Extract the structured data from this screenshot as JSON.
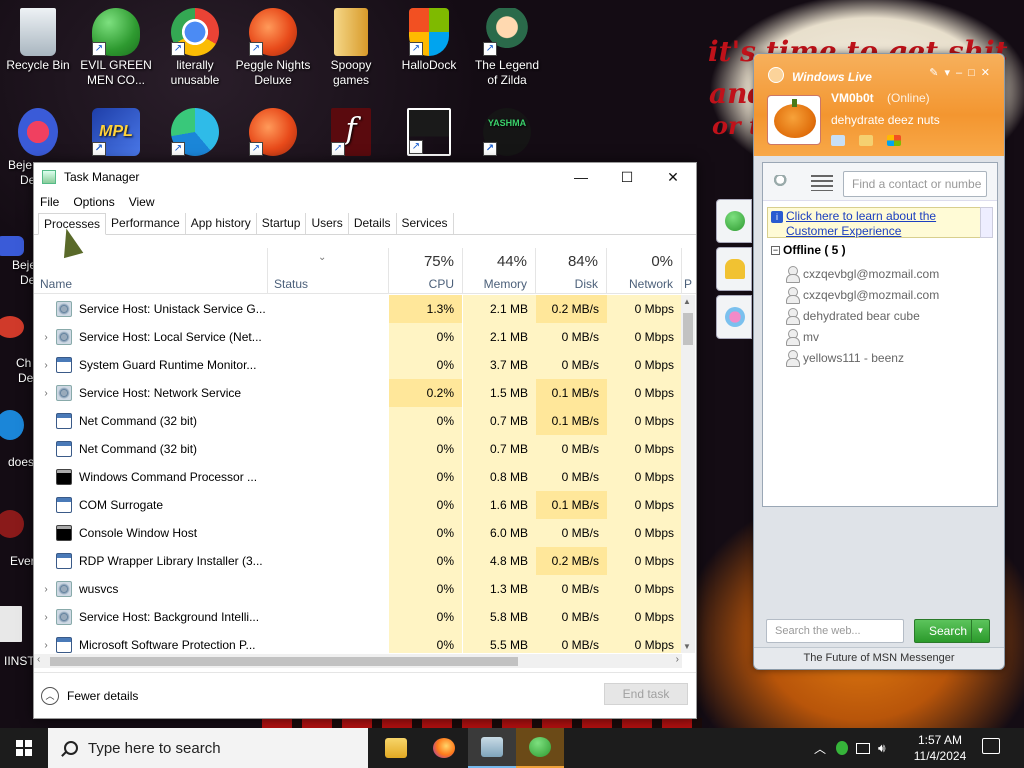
{
  "desktop": {
    "icons": [
      {
        "label": "Recycle Bin",
        "icon": "recycle-bin-icon",
        "color": "#cfd8e0"
      },
      {
        "label": "EVIL GREEN MEN CO...",
        "icon": "msn-buddies-icon",
        "color": "#36b43a"
      },
      {
        "label": "literally unusable",
        "icon": "chrome-icon",
        "color": "#e8453c"
      },
      {
        "label": "Peggle Nights Deluxe",
        "icon": "peggle-icon",
        "color": "#e84a1a"
      },
      {
        "label": "Spoopy games",
        "icon": "folder-zip-icon",
        "color": "#e8b74a"
      },
      {
        "label": "HalloDock",
        "icon": "windows-shield-icon",
        "color": "#f25022"
      },
      {
        "label": "The Legend of Zilda",
        "icon": "legend-zilda-icon",
        "color": "#3a8a3a"
      }
    ],
    "row2_icons": [
      {
        "label": "",
        "icon": "bejeweled-icon",
        "color": "#3a5bd8"
      },
      {
        "label": "",
        "icon": "mpl-icon",
        "color": "#1e3ea8"
      },
      {
        "label": "",
        "icon": "edge-icon",
        "color": "#1b86d8"
      },
      {
        "label": "",
        "icon": "peggle-icon",
        "color": "#e84a1a"
      },
      {
        "label": "",
        "icon": "flash-icon",
        "color": "#c8131a"
      },
      {
        "label": "",
        "icon": "rdp-icon",
        "color": "#ffffff"
      },
      {
        "label": "",
        "icon": "yashma-icon",
        "color": "#1a1a1a"
      }
    ],
    "partial_labels": [
      "Beje",
      "De",
      "Beje",
      "De",
      "Ch",
      "De",
      "does",
      "Ever",
      "IINST"
    ],
    "wall_text": [
      "it's time to get shit",
      "and",
      "or t"
    ]
  },
  "task_manager": {
    "title": "Task Manager",
    "menu": [
      "File",
      "Options",
      "View"
    ],
    "tabs": [
      "Processes",
      "Performance",
      "App history",
      "Startup",
      "Users",
      "Details",
      "Services"
    ],
    "active_tab": "Processes",
    "columns": {
      "name": "Name",
      "status": "Status",
      "cpu": {
        "pct": "75%",
        "label": "CPU"
      },
      "memory": {
        "pct": "44%",
        "label": "Memory"
      },
      "disk": {
        "pct": "84%",
        "label": "Disk"
      },
      "network": {
        "pct": "0%",
        "label": "Network"
      },
      "power": "P"
    },
    "rows": [
      {
        "expand": false,
        "icon": "svc",
        "name": "Service Host: Unistack Service G...",
        "cpu": "1.3%",
        "mem": "2.1 MB",
        "disk": "0.2 MB/s",
        "net": "0 Mbps"
      },
      {
        "expand": true,
        "icon": "svc",
        "name": "Service Host: Local Service (Net...",
        "cpu": "0%",
        "mem": "2.1 MB",
        "disk": "0 MB/s",
        "net": "0 Mbps"
      },
      {
        "expand": true,
        "icon": "win",
        "name": "System Guard Runtime Monitor...",
        "cpu": "0%",
        "mem": "3.7 MB",
        "disk": "0 MB/s",
        "net": "0 Mbps"
      },
      {
        "expand": true,
        "icon": "svc",
        "name": "Service Host: Network Service",
        "cpu": "0.2%",
        "mem": "1.5 MB",
        "disk": "0.1 MB/s",
        "net": "0 Mbps"
      },
      {
        "expand": false,
        "icon": "win",
        "name": "Net Command (32 bit)",
        "cpu": "0%",
        "mem": "0.7 MB",
        "disk": "0.1 MB/s",
        "net": "0 Mbps"
      },
      {
        "expand": false,
        "icon": "win",
        "name": "Net Command (32 bit)",
        "cpu": "0%",
        "mem": "0.7 MB",
        "disk": "0 MB/s",
        "net": "0 Mbps"
      },
      {
        "expand": false,
        "icon": "cmd",
        "name": "Windows Command Processor ...",
        "cpu": "0%",
        "mem": "0.8 MB",
        "disk": "0 MB/s",
        "net": "0 Mbps"
      },
      {
        "expand": false,
        "icon": "win",
        "name": "COM Surrogate",
        "cpu": "0%",
        "mem": "1.6 MB",
        "disk": "0.1 MB/s",
        "net": "0 Mbps"
      },
      {
        "expand": false,
        "icon": "cmd",
        "name": "Console Window Host",
        "cpu": "0%",
        "mem": "6.0 MB",
        "disk": "0 MB/s",
        "net": "0 Mbps"
      },
      {
        "expand": false,
        "icon": "win",
        "name": "RDP Wrapper Library Installer (3...",
        "cpu": "0%",
        "mem": "4.8 MB",
        "disk": "0.2 MB/s",
        "net": "0 Mbps"
      },
      {
        "expand": true,
        "icon": "svc",
        "name": "wusvcs",
        "cpu": "0%",
        "mem": "1.3 MB",
        "disk": "0 MB/s",
        "net": "0 Mbps"
      },
      {
        "expand": true,
        "icon": "svc",
        "name": "Service Host: Background Intelli...",
        "cpu": "0%",
        "mem": "5.8 MB",
        "disk": "0 MB/s",
        "net": "0 Mbps"
      },
      {
        "expand": true,
        "icon": "win",
        "name": "Microsoft Software Protection P...",
        "cpu": "0%",
        "mem": "5.5 MB",
        "disk": "0 MB/s",
        "net": "0 Mbps"
      }
    ],
    "fewer_details": "Fewer details",
    "end_task": "End task"
  },
  "messenger": {
    "brand": "Windows Live",
    "username": "VM0b0t",
    "status": "(Online)",
    "personal_message": "dehydrate deez nuts",
    "find_placeholder": "Find a contact or numbe",
    "info_link": "Click here to learn about the Customer Experience",
    "group": "Offline ( 5 )",
    "contacts": [
      "cxzqevbgl@mozmail.com",
      "cxzqevbgl@mozmail.com",
      "dehydrated bear cube",
      "mv",
      "yellows111 - beenz"
    ],
    "search_placeholder": "Search the web...",
    "search_button": "Search",
    "footer": "The Future of MSN Messenger"
  },
  "taskbar": {
    "search_placeholder": "Type here to search",
    "apps": [
      {
        "icon": "file-explorer-icon",
        "color": "#f0c030"
      },
      {
        "icon": "firefox-icon",
        "color": "#ff7a1a"
      },
      {
        "icon": "task-manager-icon",
        "color": "#8fb3c8"
      },
      {
        "icon": "msn-messenger-icon",
        "color": "#36b43a"
      }
    ],
    "time": "1:57 AM",
    "date": "11/4/2024"
  }
}
